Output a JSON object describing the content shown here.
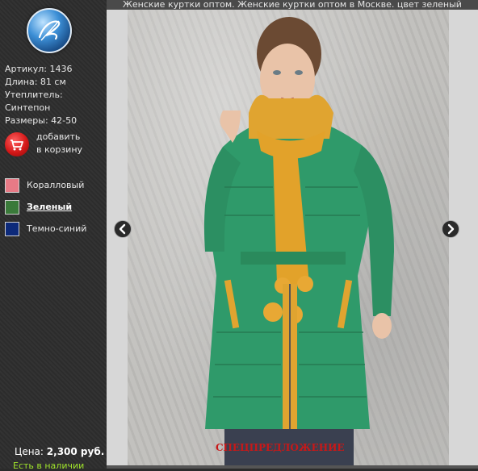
{
  "page": {
    "caption": "Женские куртки оптом. Женские куртки оптом в Москве. цвет зеленый"
  },
  "logo": {
    "icon": "brand-logo-icon"
  },
  "product": {
    "article": "Артикул: 1436",
    "length": "Длина: 81 см",
    "insulation_label": "Утеплитель:",
    "insulation_value": "Синтепон",
    "sizes": "Размеры: 42-50"
  },
  "cart": {
    "line1": "добавить",
    "line2": "в корзину",
    "icon": "cart-icon"
  },
  "colors": [
    {
      "label": "Коралловый",
      "hex": "#e87a86",
      "active": false
    },
    {
      "label": "Зеленый",
      "hex": "#3a7a3a",
      "active": true
    },
    {
      "label": "Темно-синий",
      "hex": "#0d2a7a",
      "active": false
    }
  ],
  "price": {
    "label": "Цена:",
    "value": "2,300 руб."
  },
  "stock": "Есть в наличии",
  "special_offer": "СПЕЦПРЕДЛОЖЕНИЕ",
  "gallery": {
    "prev_icon": "chevron-left-icon",
    "next_icon": "chevron-right-icon"
  }
}
